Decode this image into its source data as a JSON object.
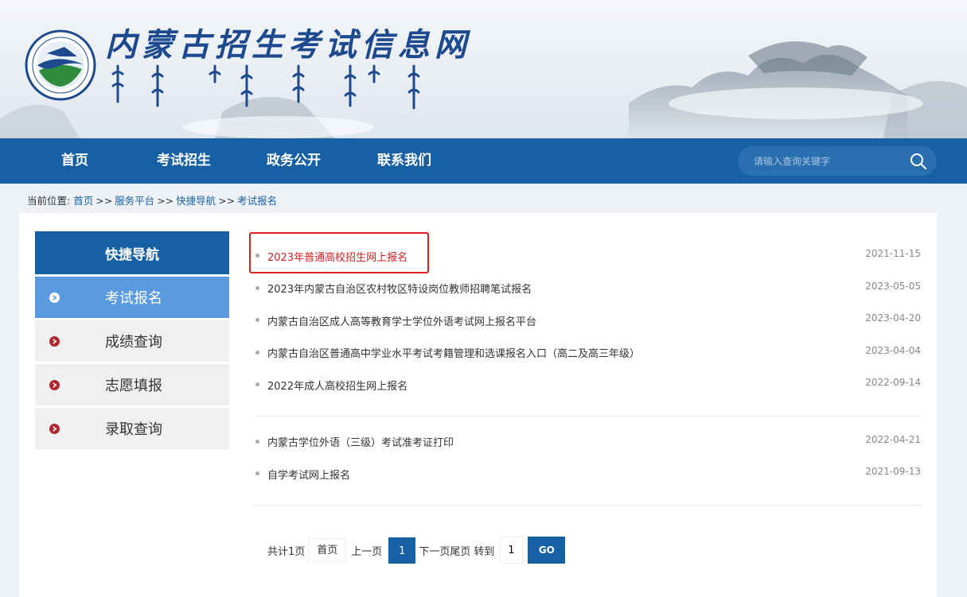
{
  "header": {
    "site_title": "内蒙古招生考试信息网"
  },
  "nav": {
    "items": [
      {
        "label": "首页"
      },
      {
        "label": "考试招生"
      },
      {
        "label": "政务公开"
      },
      {
        "label": "联系我们"
      }
    ],
    "search_placeholder": "请输入查询关键字"
  },
  "breadcrumb": {
    "prefix": "当前位置:",
    "items": [
      "首页",
      "服务平台",
      "快捷导航",
      "考试报名"
    ],
    "separator": ">>"
  },
  "sidebar": {
    "header": "快捷导航",
    "items": [
      {
        "label": "考试报名",
        "active": true
      },
      {
        "label": "成绩查询",
        "active": false
      },
      {
        "label": "志愿填报",
        "active": false
      },
      {
        "label": "录取查询",
        "active": false
      }
    ]
  },
  "list": {
    "group1": [
      {
        "title": "2023年普通高校招生网上报名",
        "date": "2021-11-15",
        "highlighted": true
      },
      {
        "title": "2023年内蒙古自治区农村牧区特设岗位教师招聘笔试报名",
        "date": "2023-05-05"
      },
      {
        "title": "内蒙古自治区成人高等教育学士学位外语考试网上报名平台",
        "date": "2023-04-20"
      },
      {
        "title": "内蒙古自治区普通高中学业水平考试考籍管理和选课报名入口（高二及高三年级）",
        "date": "2023-04-04"
      },
      {
        "title": "2022年成人高校招生网上报名",
        "date": "2022-09-14"
      }
    ],
    "group2": [
      {
        "title": "内蒙古学位外语（三级）考试准考证打印",
        "date": "2022-04-21"
      },
      {
        "title": "自学考试网上报名",
        "date": "2021-09-13"
      }
    ]
  },
  "pager": {
    "total_text": "共计1页",
    "first": "首页",
    "prev": "上一页",
    "current": "1",
    "next": "下一页",
    "last": "尾页",
    "goto_label": "转到",
    "goto_value": "1",
    "go": "GO"
  },
  "colors": {
    "primary": "#1760a6",
    "sidebar_active": "#5a9be0",
    "hot_link": "#d42020",
    "bullet": "#b0282e"
  }
}
